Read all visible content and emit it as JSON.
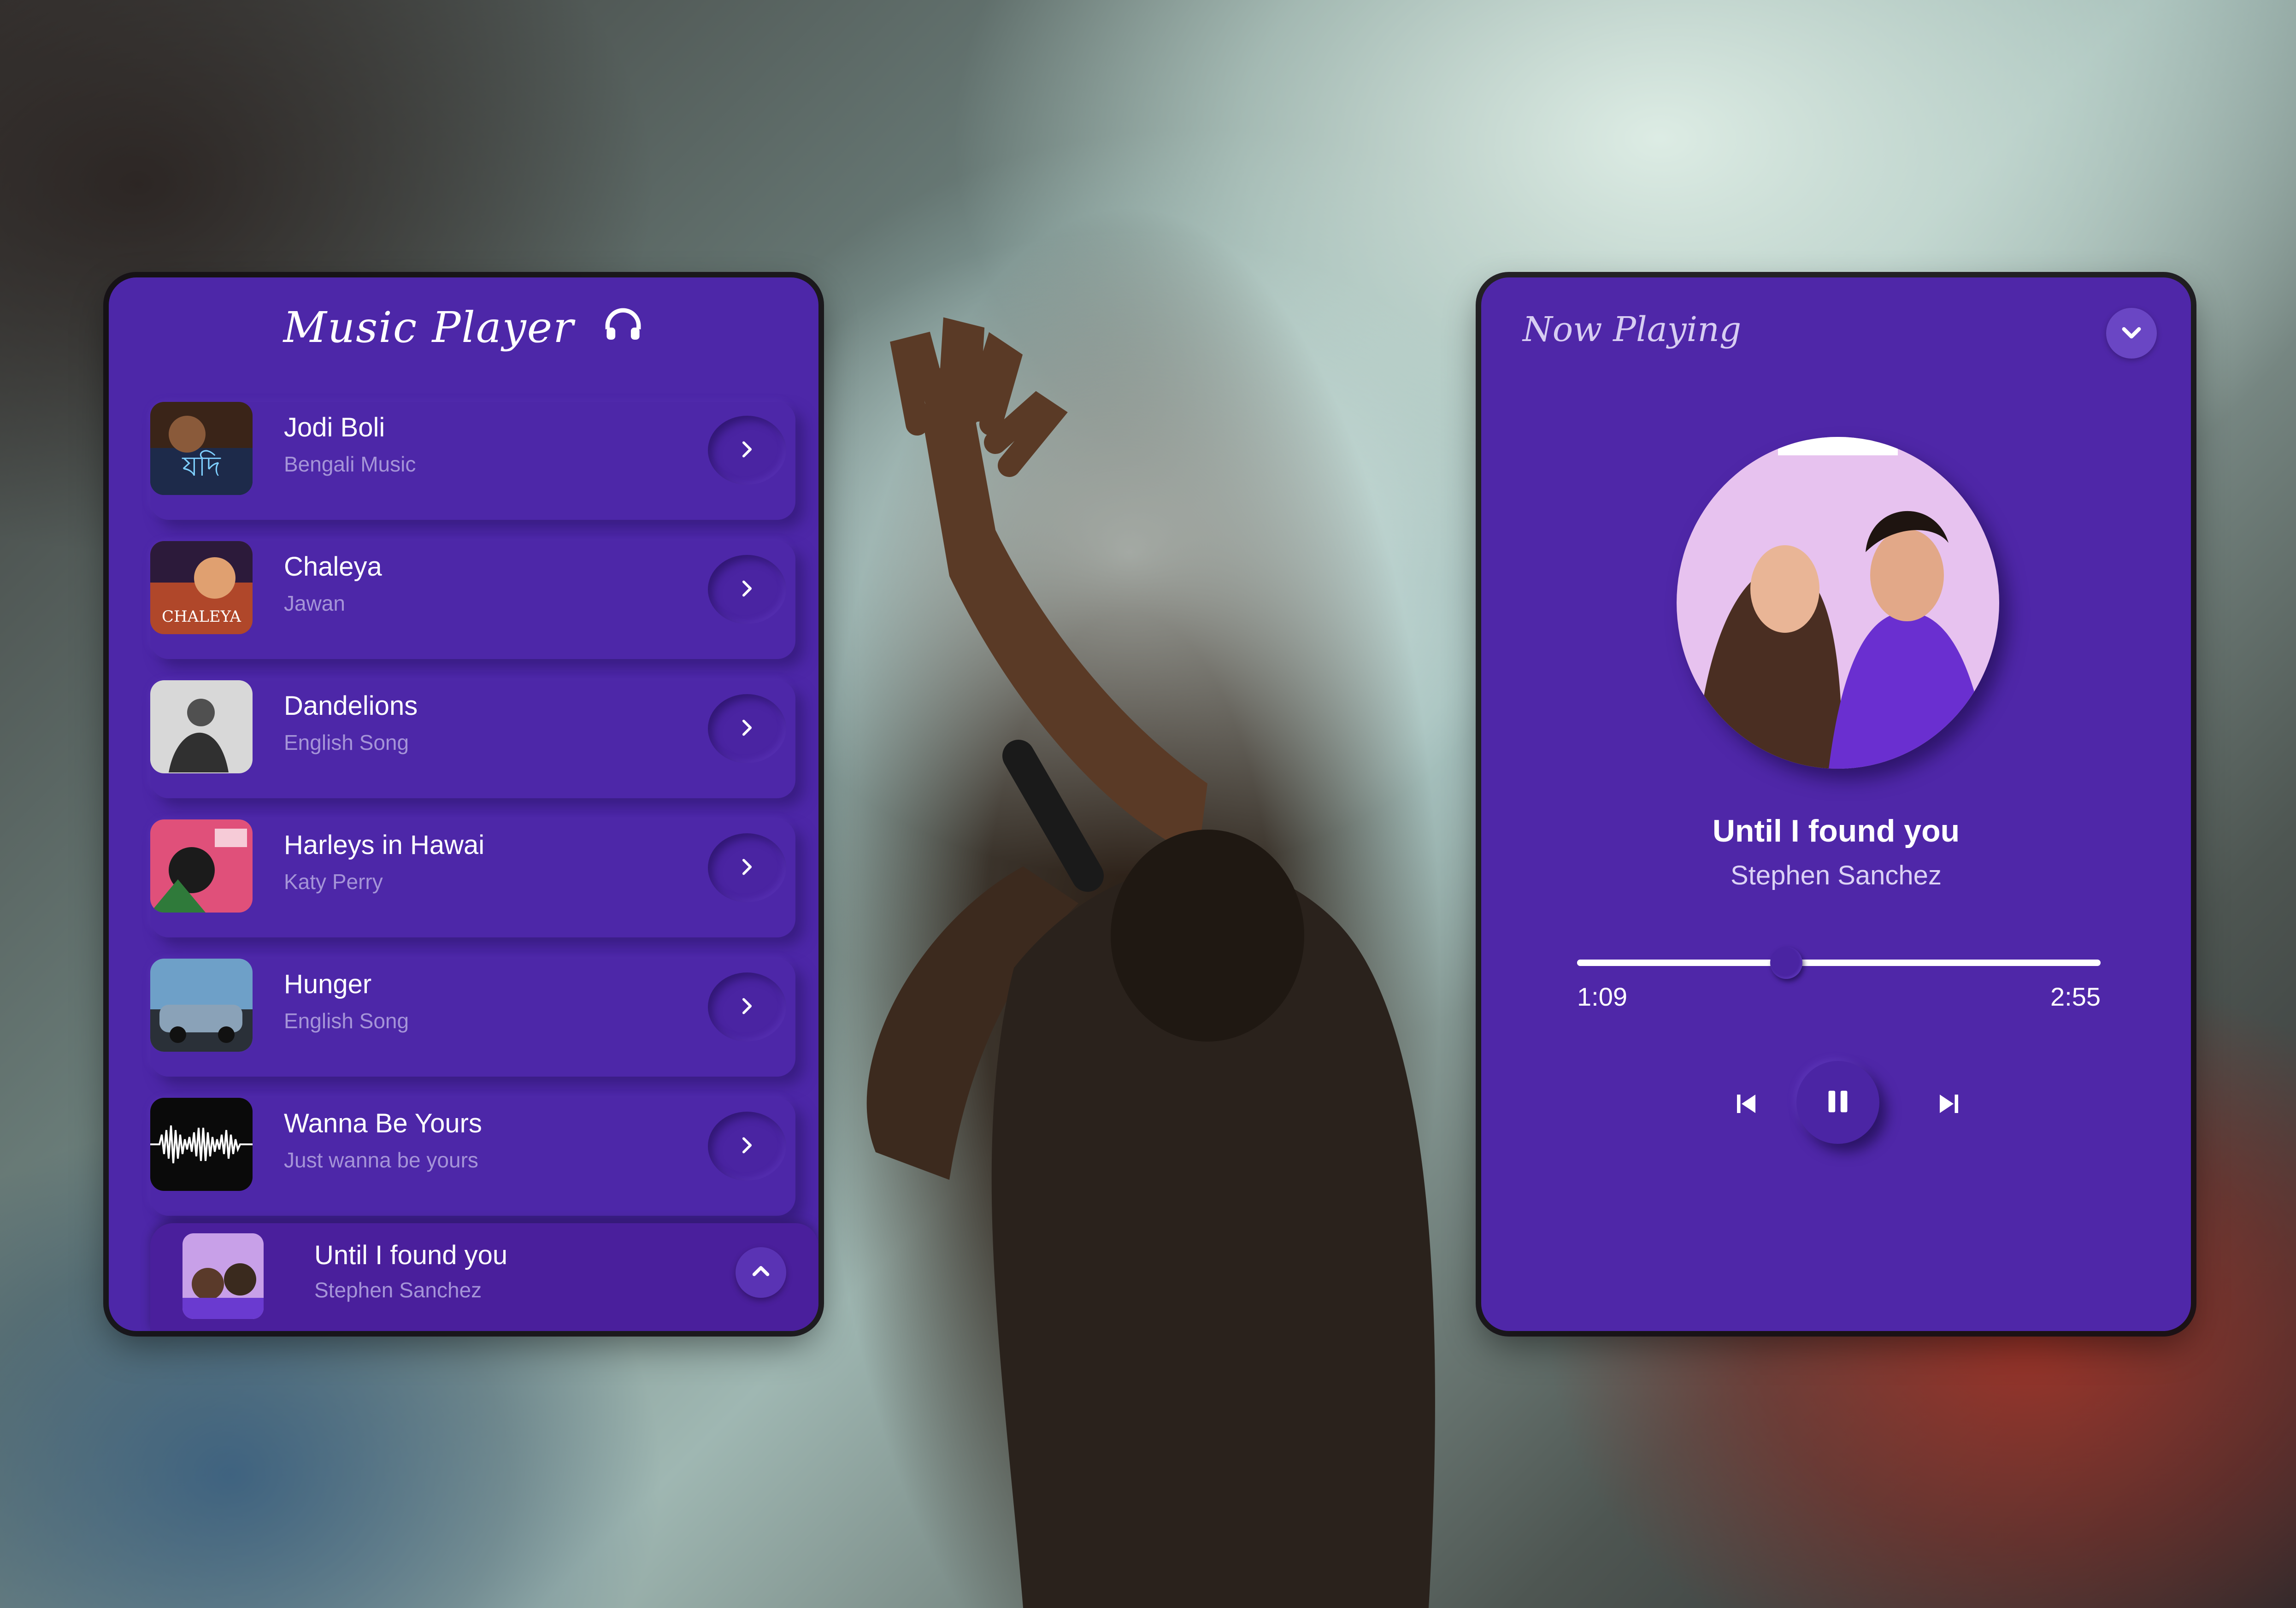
{
  "colors": {
    "panel": "#4d27a8",
    "accent_text": "#a594d8",
    "white": "#ffffff"
  },
  "library": {
    "title": "Music Player",
    "title_icon": "headphones-icon",
    "songs": [
      {
        "title": "Jodi Boli",
        "subtitle": "Bengali Music"
      },
      {
        "title": "Chaleya",
        "subtitle": "Jawan"
      },
      {
        "title": "Dandelions",
        "subtitle": "English Song"
      },
      {
        "title": "Harleys in Hawai",
        "subtitle": "Katy Perry"
      },
      {
        "title": "Hunger",
        "subtitle": "English Song"
      },
      {
        "title": "Wanna Be Yours",
        "subtitle": "Just wanna be yours"
      }
    ],
    "mini_player": {
      "title": "Until I found you",
      "subtitle": "Stephen Sanchez",
      "icon": "chevron-up-icon"
    }
  },
  "now_playing": {
    "label": "Now Playing",
    "collapse_icon": "chevron-down-icon",
    "title": "Until I found you",
    "artist": "Stephen Sanchez",
    "current_time": "1:09",
    "total_time": "2:55",
    "progress": 0.4,
    "controls": {
      "prev": "skip-back-icon",
      "play": "pause-icon",
      "next": "skip-forward-icon"
    }
  }
}
